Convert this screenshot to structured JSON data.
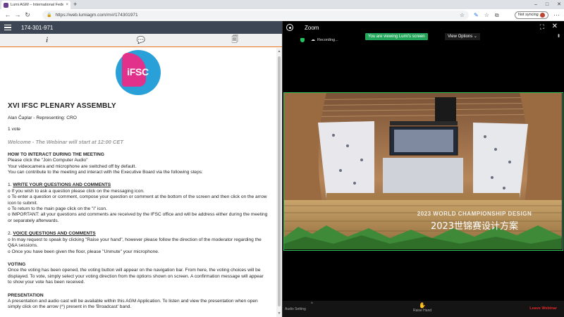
{
  "browser": {
    "tab_title": "Lumi AGM – International Feder",
    "tab_close": "×",
    "new_tab": "+",
    "url_prefix": "https://",
    "url": "web.lumiagm.com/m#/174301971",
    "not_syncing": "Not syncing",
    "back": "←",
    "forward": "→",
    "reload": "↻",
    "minimize": "–",
    "maximize": "□",
    "close": "✕",
    "more": "⋯"
  },
  "left": {
    "meeting_id": "174-301-971",
    "tabs": [
      {
        "name": "info",
        "icon": "i"
      },
      {
        "name": "messaging",
        "icon": "💬"
      },
      {
        "name": "documents",
        "icon": "🗐"
      }
    ],
    "logo_text": "iFSC",
    "heading": "XVI IFSC PLENARY ASSEMBLY",
    "user": "Alan Čaplar - Representing: CRO",
    "votes": "1 vote",
    "welcome": "Welcome - The Webinar will start at 12:00 CET",
    "how_heading": "HOW TO INTERACT DURING THE MEETING",
    "how_lines": [
      "Please click the \"Join Computer Audio\"",
      "Your videocamera and microphone are switched off by default.",
      "You can contribute to the meeting and interact with the Executive Board via the following steps:"
    ],
    "s1_num": "1. ",
    "s1_title": "WRITE YOUR QUESTIONS AND COMMENTS",
    "s1_lines": [
      "o If you wish to ask a question please click on the messaging icon.",
      "o To enter a question or comment, compose your question or comment at the bottom of the screen and then click on the arrow icon to submit.",
      "o To return to the main page click on the \"i\" icon.",
      "o IMPORTANT: all your questions and comments are received by the IFSC office and will be address either during the meeting or separately afterwards."
    ],
    "s2_num": "2. ",
    "s2_title": "VOICE QUESTIONS AND COMMENTS",
    "s2_lines": [
      "o In may request to speak by clicking \"Raise your hand\", however please follow the direction of the moderator regarding the Q&A sessions.",
      "o Once you have been given the floor, please \"Unmute\" your microphone."
    ],
    "voting_title": "VOTING",
    "voting_text": "Once the voting has been opened, the voting button will appear on the navigation bar. From here, the voting choices will be displayed. To vote, simply select your voting direction from the options shown on screen. A confirmation message will appear to show your vote has been received.",
    "presentation_title": "PRESENTATION",
    "presentation_text": "A presentation and audio cast will be available within this AGM Application. To listen and view the presentation when open simply click on the arrow (^) present in the 'Broadcast' band."
  },
  "zoom": {
    "title": "Zoom",
    "recording": "Recording...",
    "viewing": "You are viewing Lumi's screen",
    "view_options": "View Options",
    "share_caption_en": "2023 WORLD CHAMPIONSHIP DESIGN",
    "share_caption_zh": "2023世锦赛设计方案",
    "audio_settings": "Audio Setting",
    "raise_hand": "Raise Hand",
    "leave": "Leave Webinar",
    "accent": "#2fc55b",
    "leave_color": "#e02828"
  }
}
